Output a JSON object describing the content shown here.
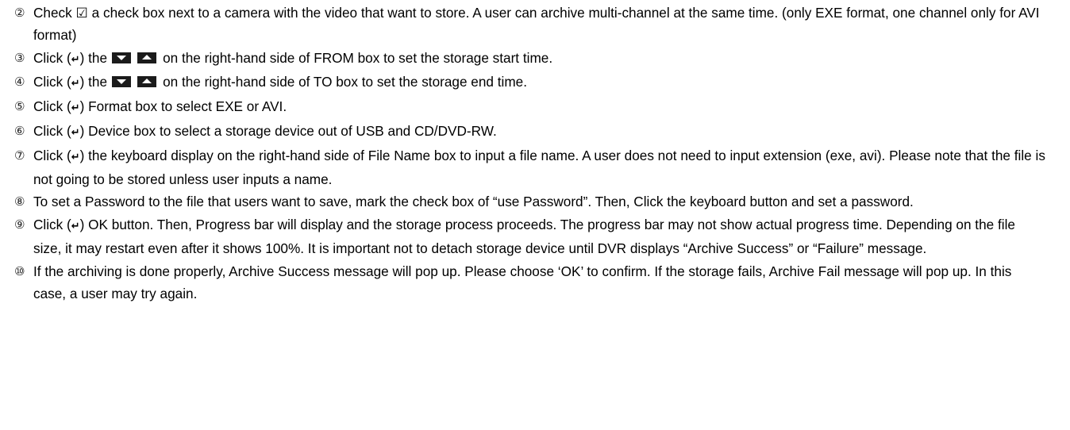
{
  "steps": [
    {
      "num": "②",
      "text": "Check ☑ a check box next to a camera with the video that want to store. A user can archive multi-channel at the same time. (only EXE format, one channel only for AVI format)"
    },
    {
      "num": "③",
      "pre": "Click (",
      "enter": "↵",
      "mid": ") the",
      "post": "on the right-hand side of FROM box to set the storage start time."
    },
    {
      "num": "④",
      "pre": "Click (",
      "enter": "↵",
      "mid": ") the",
      "post": "on the right-hand side of TO box to set the storage end time."
    },
    {
      "num": "⑤",
      "pre": "Click (",
      "enter": "↵",
      "post": ") Format box to select EXE or AVI."
    },
    {
      "num": "⑥",
      "pre": "Click (",
      "enter": "↵",
      "post": ") Device box to select a storage device out of USB and CD/DVD-RW."
    },
    {
      "num": "⑦",
      "pre": "Click (",
      "enter": "↵",
      "post": ") the keyboard display on the right-hand side of File Name box to input a file name. A user does not need to input extension (exe, avi). Please note that the file is not going to be stored unless user inputs a name."
    },
    {
      "num": "⑧",
      "text": "To set a Password to the file that users want to save, mark the check box of “use Password”. Then, Click the keyboard button and set a password."
    },
    {
      "num": "⑨",
      "pre": "Click (",
      "enter": "↵",
      "post": ") OK button. Then, Progress bar will display and the storage process proceeds. The progress bar may not show actual progress time. Depending on the file size, it may restart even after it shows 100%. It is important not to detach storage device until DVR displays “Archive Success” or “Failure” message."
    },
    {
      "num": "⑩",
      "text": "If the archiving is done properly, Archive Success message will pop up. Please choose ‘OK’ to confirm. If the storage fails, Archive Fail message will pop up. In this case, a user may try again."
    }
  ],
  "icons": {
    "enter": "enter-key-icon",
    "down": "down-arrow-button-icon",
    "up": "up-arrow-button-icon"
  }
}
